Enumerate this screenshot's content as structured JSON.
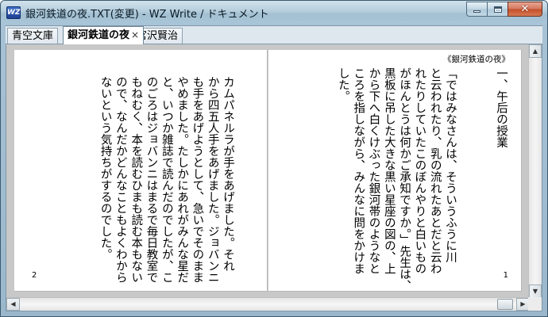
{
  "window": {
    "title": "銀河鉄道の夜.TXT(変更) - WZ Write / ドキュメント",
    "app_icon_label": "WZ"
  },
  "tabs": [
    {
      "label": "青空文庫",
      "active": false
    },
    {
      "label": "銀河鉄道の夜",
      "active": true,
      "close": "×"
    },
    {
      "label": "宮沢賢治",
      "active": false
    }
  ],
  "document": {
    "running_head": "《銀河鉄道の夜》",
    "right_page": {
      "heading": "一、午后の授業",
      "body": "「ではみなさんは、そういうふうに川\nと云われたり、乳の流れたあとだと云わ\nれたりしていたこのぼんやりと白いもの\nがほんとうは何かご承知ですか。」先生は、\n黒板に吊した大きな黒い星座の図の、上\nから下へ白くけぶった銀河帯のようなと\nころを指しながら、みんなに問をかけま\nした。",
      "page_number": "1"
    },
    "left_page": {
      "body": "カムパネルラが手をあげました。それ\nから四五人手をあげました。ジョバンニ\nも手をあげようとして、急いでそのまま\nやめました。たしかにあれがみんな星だ\nと、いつか雑誌で読んだのでしたが、こ\nのごろはジョバンニはまるで毎日教室で\nもねむく、本を読むひまも読む本もない\nので、なんだかどんなこともよくわから\nないという気持ちがするのでした。",
      "page_number": "2"
    }
  },
  "colors": {
    "title_bar": "#b4cddc",
    "close_button": "#c44d2a",
    "workspace": "#c8c8c8"
  },
  "icons": {
    "minimize": "minimize-icon",
    "maximize": "maximize-icon",
    "close": "close-icon"
  }
}
